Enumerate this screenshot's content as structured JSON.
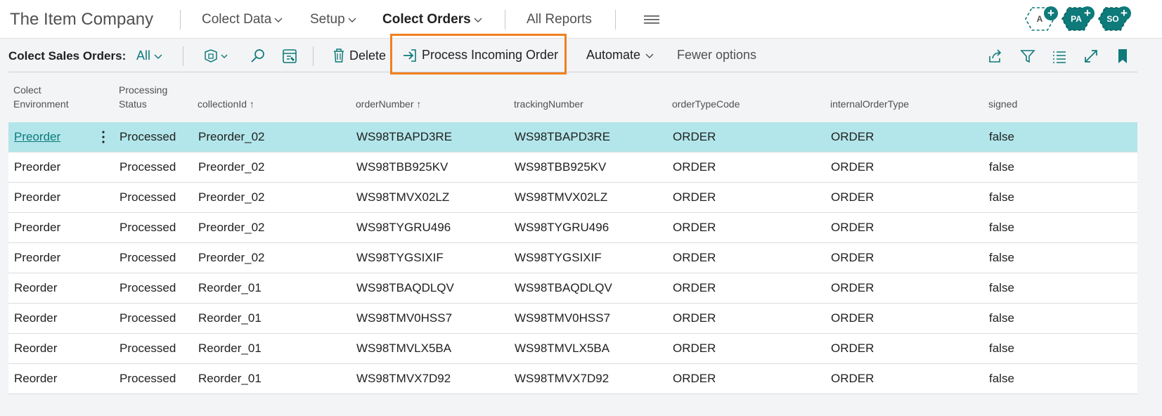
{
  "app": {
    "company": "The Item Company"
  },
  "nav": {
    "items": [
      {
        "label": "Colect Data"
      },
      {
        "label": "Setup"
      },
      {
        "label": "Colect Orders"
      },
      {
        "label": "All Reports"
      }
    ]
  },
  "avatars": [
    {
      "initials": "A"
    },
    {
      "initials": "PA"
    },
    {
      "initials": "SO"
    }
  ],
  "actionbar": {
    "title": "Colect Sales Orders:",
    "filter": "All",
    "delete_label": "Delete",
    "process_label": "Process Incoming Order",
    "automate_label": "Automate",
    "fewer_label": "Fewer options"
  },
  "colors": {
    "accent": "#0e7a7a",
    "selected_row": "#b2e6ea",
    "highlight": "#f08020"
  },
  "table": {
    "headers": [
      {
        "line1": "Colect",
        "line2": "Environment"
      },
      {
        "line1": "Processing",
        "line2": "Status"
      },
      {
        "line1": "",
        "line2": "collectionId ↑"
      },
      {
        "line1": "",
        "line2": "orderNumber ↑"
      },
      {
        "line1": "",
        "line2": "trackingNumber"
      },
      {
        "line1": "",
        "line2": "orderTypeCode"
      },
      {
        "line1": "",
        "line2": "internalOrderType"
      },
      {
        "line1": "",
        "line2": "signed"
      }
    ],
    "rows": [
      [
        "Preorder",
        "Processed",
        "Preorder_02",
        "WS98TBAPD3RE",
        "WS98TBAPD3RE",
        "ORDER",
        "ORDER",
        "false"
      ],
      [
        "Preorder",
        "Processed",
        "Preorder_02",
        "WS98TBB925KV",
        "WS98TBB925KV",
        "ORDER",
        "ORDER",
        "false"
      ],
      [
        "Preorder",
        "Processed",
        "Preorder_02",
        "WS98TMVX02LZ",
        "WS98TMVX02LZ",
        "ORDER",
        "ORDER",
        "false"
      ],
      [
        "Preorder",
        "Processed",
        "Preorder_02",
        "WS98TYGRU496",
        "WS98TYGRU496",
        "ORDER",
        "ORDER",
        "false"
      ],
      [
        "Preorder",
        "Processed",
        "Preorder_02",
        "WS98TYGSIXIF",
        "WS98TYGSIXIF",
        "ORDER",
        "ORDER",
        "false"
      ],
      [
        "Reorder",
        "Processed",
        "Reorder_01",
        "WS98TBAQDLQV",
        "WS98TBAQDLQV",
        "ORDER",
        "ORDER",
        "false"
      ],
      [
        "Reorder",
        "Processed",
        "Reorder_01",
        "WS98TMV0HSS7",
        "WS98TMV0HSS7",
        "ORDER",
        "ORDER",
        "false"
      ],
      [
        "Reorder",
        "Processed",
        "Reorder_01",
        "WS98TMVLX5BA",
        "WS98TMVLX5BA",
        "ORDER",
        "ORDER",
        "false"
      ],
      [
        "Reorder",
        "Processed",
        "Reorder_01",
        "WS98TMVX7D92",
        "WS98TMVX7D92",
        "ORDER",
        "ORDER",
        "false"
      ]
    ]
  }
}
